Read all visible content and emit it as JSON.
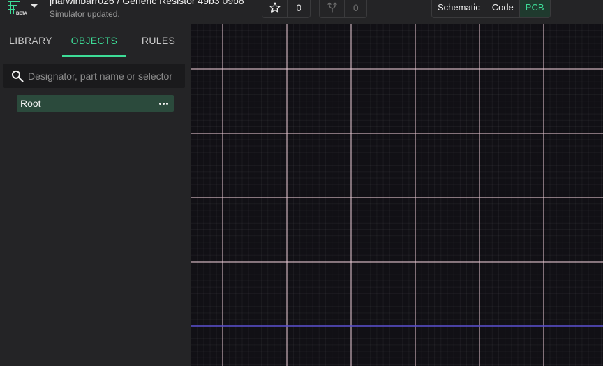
{
  "app": {
    "logo_badge": "BETA",
    "project_title": "jnarwinbarr026 / Generic Resistor 49b3 09b8",
    "status_text": "Simulator updated."
  },
  "toolbar": {
    "star_icon": "star-icon",
    "star_count": "0",
    "fork_icon": "fork-icon",
    "fork_count": "0"
  },
  "view_tabs": [
    {
      "label": "Schematic",
      "active": false
    },
    {
      "label": "Code",
      "active": false
    },
    {
      "label": "PCB",
      "active": true
    }
  ],
  "sidebar": {
    "tabs": [
      {
        "label": "LIBRARY",
        "active": false
      },
      {
        "label": "OBJECTS",
        "active": true
      },
      {
        "label": "RULES",
        "active": false
      }
    ],
    "search": {
      "placeholder": "Designator, part name or selector",
      "value": ""
    },
    "tree": [
      {
        "label": "Root",
        "menu_icon": "more-horizontal-icon"
      }
    ]
  },
  "colors": {
    "accent": "#3ddc97",
    "panel": "#242426",
    "canvas": "#111015",
    "grid_major": "#e8c9d4",
    "grid_axis": "#5a4fd0"
  }
}
